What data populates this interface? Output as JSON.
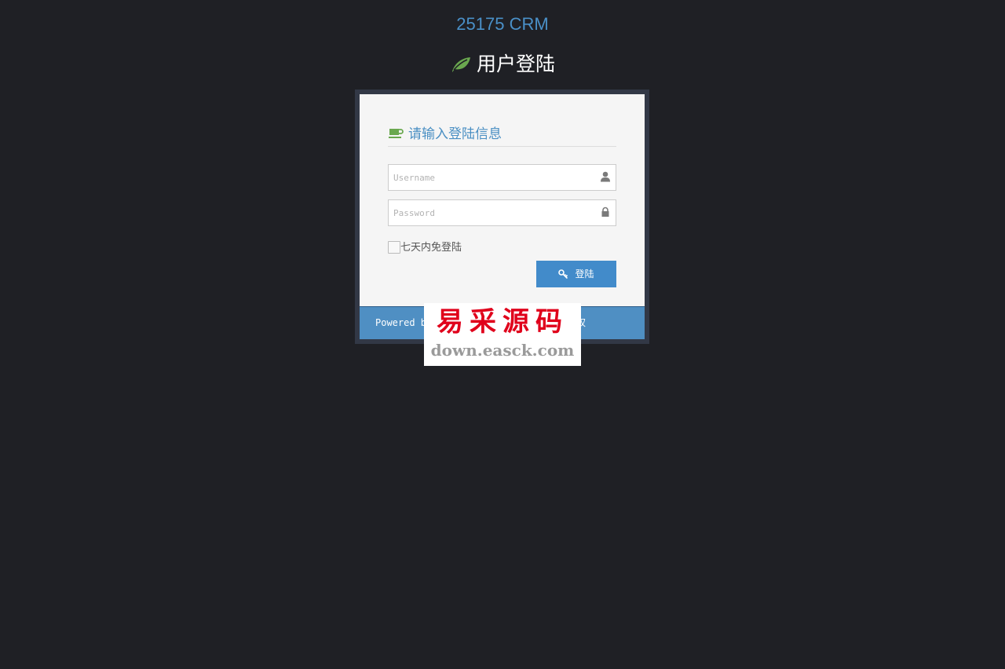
{
  "app": {
    "title": "25175 CRM"
  },
  "page": {
    "heading": "用户登陆",
    "heading_icon": "leaf-icon"
  },
  "login_box": {
    "header": "请输入登陆信息",
    "header_icon": "coffee-cup-icon",
    "username": {
      "placeholder": "Username",
      "value": "",
      "icon": "user-icon"
    },
    "password": {
      "placeholder": "Password",
      "value": "",
      "icon": "lock-icon"
    },
    "remember_label": "七天内免登陆",
    "remember_checked": false,
    "submit_label": "登陆",
    "submit_icon": "key-icon"
  },
  "footer": {
    "powered_prefix": "Powered b",
    "powered_suffix": "权"
  },
  "watermark": {
    "brand": "易采源码",
    "url": "down.easck.com"
  },
  "colors": {
    "background": "#1f2025",
    "accent_blue": "#428bca",
    "title_blue": "#4a90c8",
    "icon_green": "#6aa84f",
    "frame": "#323846"
  }
}
